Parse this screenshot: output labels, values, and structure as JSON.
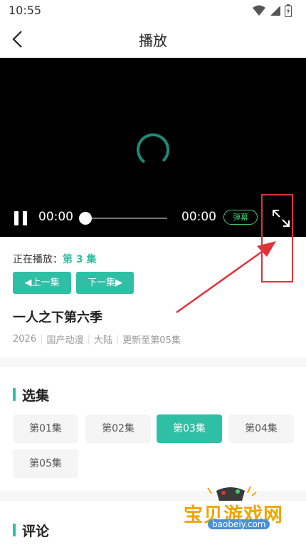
{
  "status_bar": {
    "time": "10:55"
  },
  "nav": {
    "title": "播放"
  },
  "player": {
    "current_time": "00:00",
    "total_time": "00:00",
    "danmu_label": "弹幕",
    "progress": 0
  },
  "info": {
    "now_playing_label": "正在播放：",
    "current_episode": "第 3 集",
    "prev_label": "◀上一集",
    "next_label": "下一集▶",
    "title": "一人之下第六季",
    "meta": [
      "2026",
      "国产动漫",
      "大陆",
      "更新至第05集"
    ]
  },
  "episodes": {
    "heading": "选集",
    "items": [
      "第01集",
      "第02集",
      "第03集",
      "第04集",
      "第05集"
    ],
    "selected_index": 2
  },
  "comments": {
    "heading": "评论"
  },
  "watermark": {
    "text": "宝贝游戏网",
    "url": "baobeiy.com"
  },
  "colors": {
    "accent": "#2fbfa5",
    "annotation": "#e0323a",
    "danmu": "#3fcf70"
  }
}
